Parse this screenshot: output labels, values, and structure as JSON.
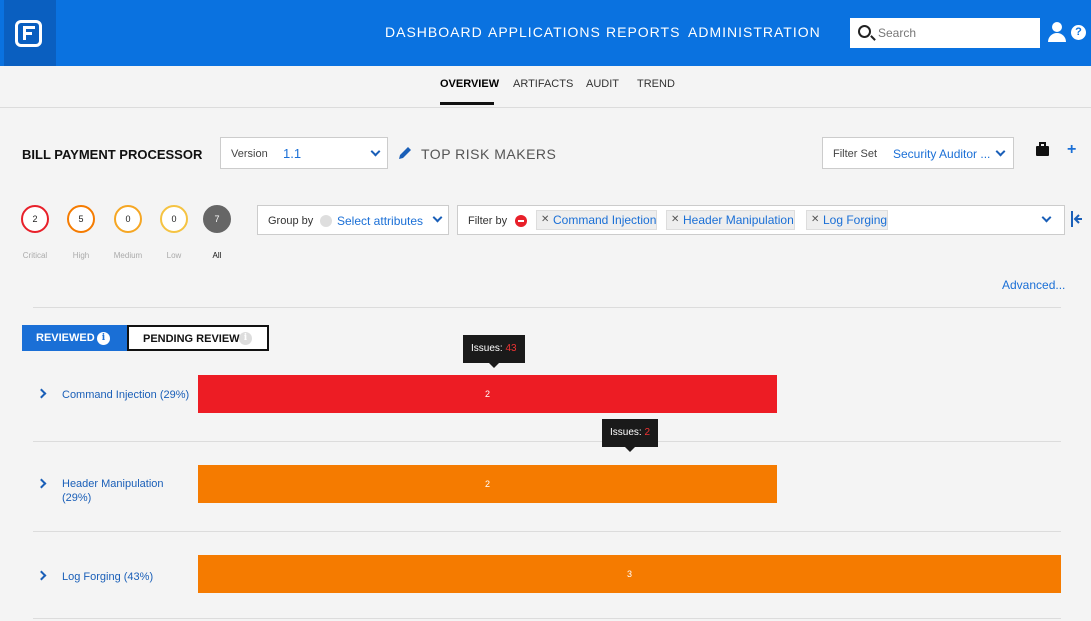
{
  "nav": {
    "items": [
      "DASHBOARD",
      "APPLICATIONS",
      "REPORTS",
      "ADMINISTRATION"
    ],
    "search_placeholder": "Search",
    "help": "?"
  },
  "tabs": [
    "OVERVIEW",
    "ARTIFACTS",
    "AUDIT",
    "TREND"
  ],
  "active_tab": "OVERVIEW",
  "header": {
    "app_title": "BILL PAYMENT PROCESSOR",
    "version_label": "Version",
    "version_value": "1.1",
    "top_risk": "TOP RISK MAKERS",
    "filterset_label": "Filter Set",
    "filterset_value": "Security Auditor ...",
    "plus": "+"
  },
  "severity": [
    {
      "label": "Critical",
      "count": "2",
      "color": "#e8202a"
    },
    {
      "label": "High",
      "count": "5",
      "color": "#f57b00"
    },
    {
      "label": "Medium",
      "count": "0",
      "color": "#f5a623"
    },
    {
      "label": "Low",
      "count": "0",
      "color": "#f5c342"
    },
    {
      "label": "All",
      "count": "7",
      "color": "#666666"
    }
  ],
  "groupby": {
    "label": "Group by",
    "value": "Select attributes"
  },
  "filterby": {
    "label": "Filter by",
    "chips": [
      "Command Injection",
      "Header Manipulation",
      "Log Forging"
    ]
  },
  "advanced": "Advanced...",
  "review": {
    "reviewed": "REVIEWED",
    "pending": "PENDING REVIEW",
    "info": "i"
  },
  "rows": [
    {
      "label": "Command Injection (29%)",
      "value": "2",
      "color": "#ed1c24"
    },
    {
      "label": "Header Manipulation (29%)",
      "value": "2",
      "color": "#f57b00"
    },
    {
      "label": "Log Forging (43%)",
      "value": "3",
      "color": "#f57b00"
    }
  ],
  "tooltips": [
    {
      "label": "Issues:",
      "value": "43"
    },
    {
      "label": "Issues:",
      "value": "2"
    }
  ]
}
